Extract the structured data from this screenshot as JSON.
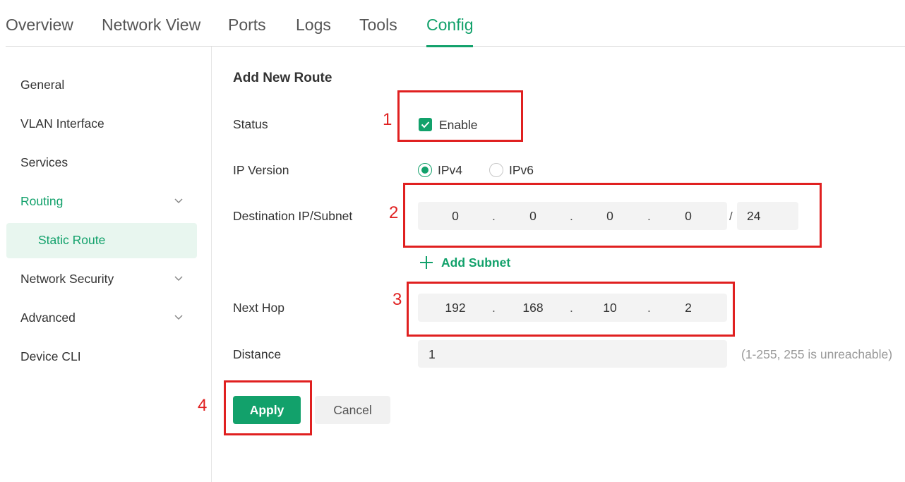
{
  "tabs": [
    {
      "label": "Overview"
    },
    {
      "label": "Network View"
    },
    {
      "label": "Ports"
    },
    {
      "label": "Logs"
    },
    {
      "label": "Tools"
    },
    {
      "label": "Config"
    }
  ],
  "active_tab": "Config",
  "sidebar": {
    "items": [
      {
        "label": "General"
      },
      {
        "label": "VLAN Interface"
      },
      {
        "label": "Services"
      },
      {
        "label": "Routing"
      },
      {
        "label": "Static Route"
      },
      {
        "label": "Network Security"
      },
      {
        "label": "Advanced"
      },
      {
        "label": "Device CLI"
      }
    ]
  },
  "form": {
    "title": "Add New Route",
    "status_label": "Status",
    "status_option": "Enable",
    "status_checked": true,
    "ip_version_label": "IP Version",
    "ipv4_label": "IPv4",
    "ipv6_label": "IPv6",
    "ip_version_selected": "IPv4",
    "dest_label": "Destination IP/Subnet",
    "dest_octets": [
      "0",
      "0",
      "0",
      "0"
    ],
    "dest_separator": ".",
    "mask_separator": "/",
    "dest_mask": "24",
    "add_subnet_label": "Add Subnet",
    "next_hop_label": "Next Hop",
    "next_hop_octets": [
      "192",
      "168",
      "10",
      "2"
    ],
    "distance_label": "Distance",
    "distance_value": "1",
    "distance_hint": "(1-255, 255 is unreachable)",
    "apply_label": "Apply",
    "cancel_label": "Cancel"
  },
  "annotations": [
    "1",
    "2",
    "3",
    "4"
  ],
  "colors": {
    "accent": "#12a16b",
    "annotation": "#e02020"
  }
}
